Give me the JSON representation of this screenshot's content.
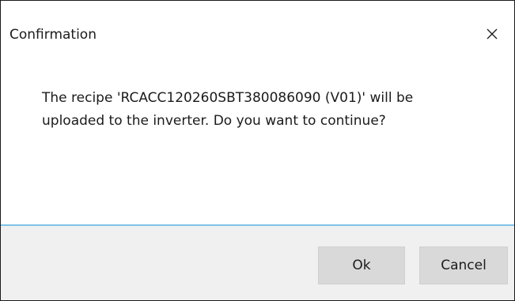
{
  "dialog": {
    "title": "Confirmation",
    "close_icon": "close-icon",
    "message_line1": "The recipe 'RCACC120260SBT380086090 (V01)' will be",
    "message_line2": "uploaded to the inverter. Do you want to continue?",
    "ok_label": "Ok",
    "cancel_label": "Cancel"
  },
  "colors": {
    "separator": "#7fc3e8",
    "footer_bg": "#f0f0f0",
    "button_bg": "#d9d9d9"
  }
}
